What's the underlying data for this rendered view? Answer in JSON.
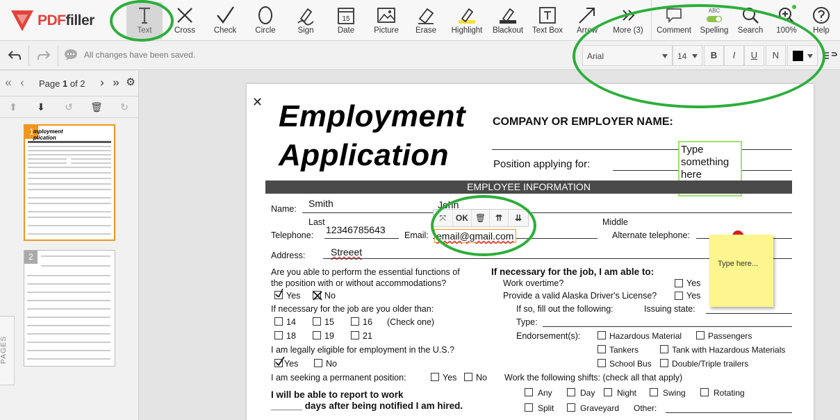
{
  "app": {
    "logo_red": "PDF",
    "logo_dark": "filler"
  },
  "tools": [
    {
      "id": "text",
      "label": "Text"
    },
    {
      "id": "cross",
      "label": "Cross"
    },
    {
      "id": "check",
      "label": "Check"
    },
    {
      "id": "circle",
      "label": "Circle"
    },
    {
      "id": "sign",
      "label": "Sign"
    },
    {
      "id": "date",
      "label": "Date"
    },
    {
      "id": "picture",
      "label": "Picture"
    },
    {
      "id": "erase",
      "label": "Erase"
    },
    {
      "id": "highlight",
      "label": "Highlight"
    },
    {
      "id": "blackout",
      "label": "Blackout"
    },
    {
      "id": "textbox",
      "label": "Text Box"
    },
    {
      "id": "arrow",
      "label": "Arrow"
    },
    {
      "id": "more",
      "label": "More (3)"
    }
  ],
  "right_tools": [
    {
      "id": "comment",
      "label": "Comment"
    },
    {
      "id": "spelling",
      "label": "Spelling",
      "badge": "ABC"
    },
    {
      "id": "search",
      "label": "Search"
    },
    {
      "id": "zoom",
      "label": "100%"
    },
    {
      "id": "help",
      "label": "Help"
    }
  ],
  "date_icon_text": "15",
  "status": "All changes have been saved.",
  "format": {
    "font": "Arial",
    "size": "14",
    "bold": "B",
    "italic": "I",
    "underline": "U",
    "normal": "N",
    "color": "#000000"
  },
  "pager": {
    "page_word": "Page",
    "current": "1",
    "of_word": "of 2"
  },
  "thumbs": [
    {
      "num": "1",
      "text": "mployment\nplication"
    },
    {
      "num": "2"
    }
  ],
  "pages_tab": "PAGES",
  "document": {
    "title1": "Employment",
    "title2": "Application",
    "company": "COMPANY OR EMPLOYER NAME:",
    "position": "Position applying for:",
    "typebox": "Type something here",
    "banner": "EMPLOYEE INFORMATION",
    "name_label": "Name:",
    "name_value": "Smith",
    "first_value": "John",
    "last_label": "Last",
    "middle_label": "Middle",
    "tel_label": "Telephone:",
    "tel_value": "12346785643",
    "email_label": "Email:",
    "email_value": "email@gmail.com",
    "alt_tel_label": "Alternate telephone:",
    "address_label": "Address:",
    "address_value": "Streeet",
    "q_essential": "Are you able to perform the essential functions of",
    "q_essential2": "the position with or without accommodations?",
    "yes": "Yes",
    "no": "No",
    "q_older": "If necessary for the job are you older than:",
    "ages": [
      "14",
      "15",
      "16",
      "18",
      "19",
      "21"
    ],
    "check_one": "(Check one)",
    "q_eligible": "I am legally eligible for employment in the U.S.?",
    "q_permanent": "I am seeking a permanent position:",
    "report1": "I will be able to report to work",
    "report2": "______ days after being notified I am hired.",
    "if_necessary": "If necessary for the job, I am able to:",
    "overtime": "Work overtime?",
    "license": "Provide a valid Alaska Driver's License?",
    "fill_out": "If so, fill out the following:",
    "issuing": "Issuing state:",
    "type": "Type:",
    "endorse": "Endorsement(s):",
    "endorsements": [
      "Hazardous Material",
      "Passengers",
      "Tankers",
      "Tank with Hazardous Materials",
      "School Bus",
      "Double/Triple trailers"
    ],
    "shifts_label": "Work the following shifts: (check all that apply)",
    "shifts": [
      "Any",
      "Day",
      "Night",
      "Swing",
      "Rotating",
      "Split",
      "Graveyard"
    ],
    "other": "Other:",
    "sticky": "Type here...",
    "ftool_ok": "OK"
  }
}
